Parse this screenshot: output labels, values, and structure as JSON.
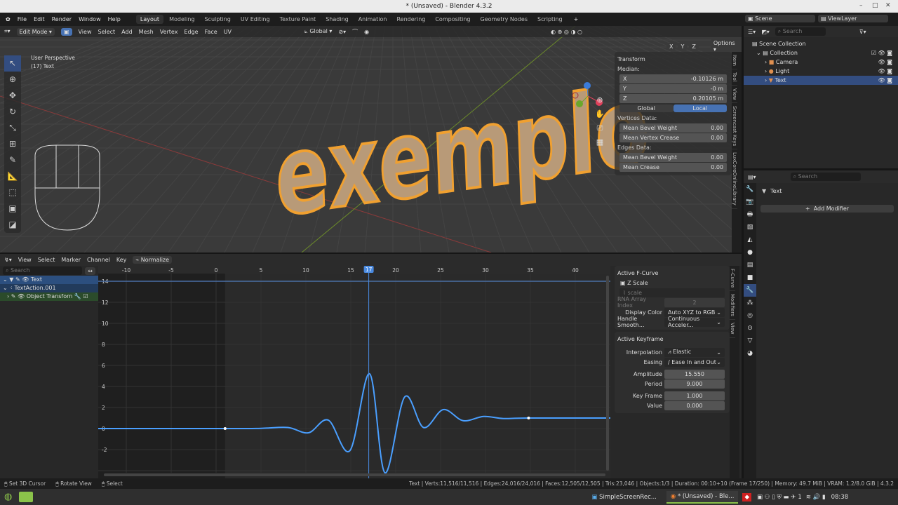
{
  "window": {
    "title": "* (Unsaved) - Blender 4.3.2"
  },
  "menu": {
    "items": [
      "File",
      "Edit",
      "Render",
      "Window",
      "Help"
    ],
    "workspaces": [
      "Layout",
      "Modeling",
      "Sculpting",
      "UV Editing",
      "Texture Paint",
      "Shading",
      "Animation",
      "Rendering",
      "Compositing",
      "Geometry Nodes",
      "Scripting"
    ],
    "active_workspace": "Layout"
  },
  "viewport": {
    "mode": "Edit Mode",
    "menus": [
      "View",
      "Select",
      "Add",
      "Mesh",
      "Vertex",
      "Edge",
      "Face",
      "UV"
    ],
    "orientation": "Global",
    "overlay_line1": "User Perspective",
    "overlay_line2": "(17) Text",
    "axes": [
      "X",
      "Y",
      "Z"
    ],
    "options": "Options",
    "object_text": "exemplo",
    "sidebar_tabs": [
      "Item",
      "Tool",
      "View",
      "Screencast Keys",
      "LuxCoreOnlineLibrary"
    ],
    "transform": {
      "header": "Transform",
      "median": "Median:",
      "x_label": "X",
      "x": "-0.10126 m",
      "y_label": "Y",
      "y": "-0 m",
      "z_label": "Z",
      "z": "0.20105 m",
      "global": "Global",
      "local": "Local",
      "vertices_data": "Vertices Data:",
      "mean_bevel_weight_v": "Mean Bevel Weight",
      "mbw_v": "0.00",
      "mean_vertex_crease": "Mean Vertex Crease",
      "mvc": "0.00",
      "edges_data": "Edges Data:",
      "mean_bevel_weight_e": "Mean Bevel Weight",
      "mbw_e": "0.00",
      "mean_crease": "Mean Crease",
      "mc": "0.00"
    }
  },
  "outliner": {
    "search": "Search",
    "scene_collection": "Scene Collection",
    "collection": "Collection",
    "items": [
      "Camera",
      "Light",
      "Text"
    ]
  },
  "properties": {
    "search": "Search",
    "object": "Text",
    "add_modifier": "Add Modifier"
  },
  "graph": {
    "menus": [
      "View",
      "Select",
      "Marker",
      "Channel",
      "Key"
    ],
    "normalize": "Normalize",
    "search": "Search",
    "channels": [
      "Text",
      "TextAction.001",
      "Object Transforn"
    ],
    "frame_ticks": [
      "-10",
      "-5",
      "0",
      "5",
      "10",
      "15",
      "20",
      "25",
      "30",
      "35",
      "40"
    ],
    "current_frame": "17",
    "value_ticks": [
      "14",
      "12",
      "10",
      "8",
      "6",
      "4",
      "2",
      "0",
      "-2"
    ],
    "sidebar_tabs": [
      "F-Curve",
      "Modifiers",
      "View"
    ],
    "fcurve": {
      "header": "Active F-Curve",
      "name": "Z Scale",
      "path": "scale",
      "rna_label": "RNA Array Index",
      "rna": "2",
      "display_color_label": "Display Color",
      "display_color": "Auto XYZ to RGB",
      "handle_label": "Handle Smooth...",
      "handle": "Continuous Acceler..."
    },
    "keyframe": {
      "header": "Active Keyframe",
      "interp_label": "Interpolation",
      "interp": "Elastic",
      "easing_label": "Easing",
      "easing": "Ease In and Out",
      "amp_label": "Amplitude",
      "amp": "15.550",
      "period_label": "Period",
      "period": "9.000",
      "frame_label": "Key Frame",
      "frame": "1.000",
      "value_label": "Value",
      "value": "0.000"
    },
    "curve_points": [
      [
        -20,
        0
      ],
      [
        1,
        0
      ],
      [
        5,
        0.02
      ],
      [
        8,
        0.1
      ],
      [
        10.3,
        -0.4
      ],
      [
        12.5,
        0.8
      ],
      [
        14.9,
        -2.1
      ],
      [
        17.1,
        5.2
      ],
      [
        18.8,
        -4.2
      ],
      [
        21,
        3.0
      ],
      [
        23.1,
        0.1
      ],
      [
        25.3,
        1.8
      ],
      [
        27.5,
        0.75
      ],
      [
        29.8,
        1.15
      ],
      [
        32,
        0.95
      ],
      [
        34.8,
        1
      ],
      [
        45,
        1
      ]
    ],
    "keyframes": [
      [
        1,
        0
      ],
      [
        34.8,
        1
      ]
    ]
  },
  "status": {
    "left": [
      "Set 3D Cursor",
      "Rotate View",
      "Select"
    ],
    "info": "Text | Verts:11,516/11,516 | Edges:24,016/24,016 | Faces:12,505/12,505 | Tris:23,046 | Objects:1/3 | Duration: 00:10+10 (Frame 17/250) | Memory: 49.7 MiB | VRAM: 1.2/8.0 GiB | 4.3.2"
  },
  "taskbar": {
    "apps": [
      "SimpleScreenRec...",
      "* (Unsaved) - Ble..."
    ],
    "workspace_num": "1",
    "clock": "08:38"
  },
  "colors": {
    "accent": "#4772b3",
    "curve": "#4a9fff",
    "object": "#f0a030"
  }
}
